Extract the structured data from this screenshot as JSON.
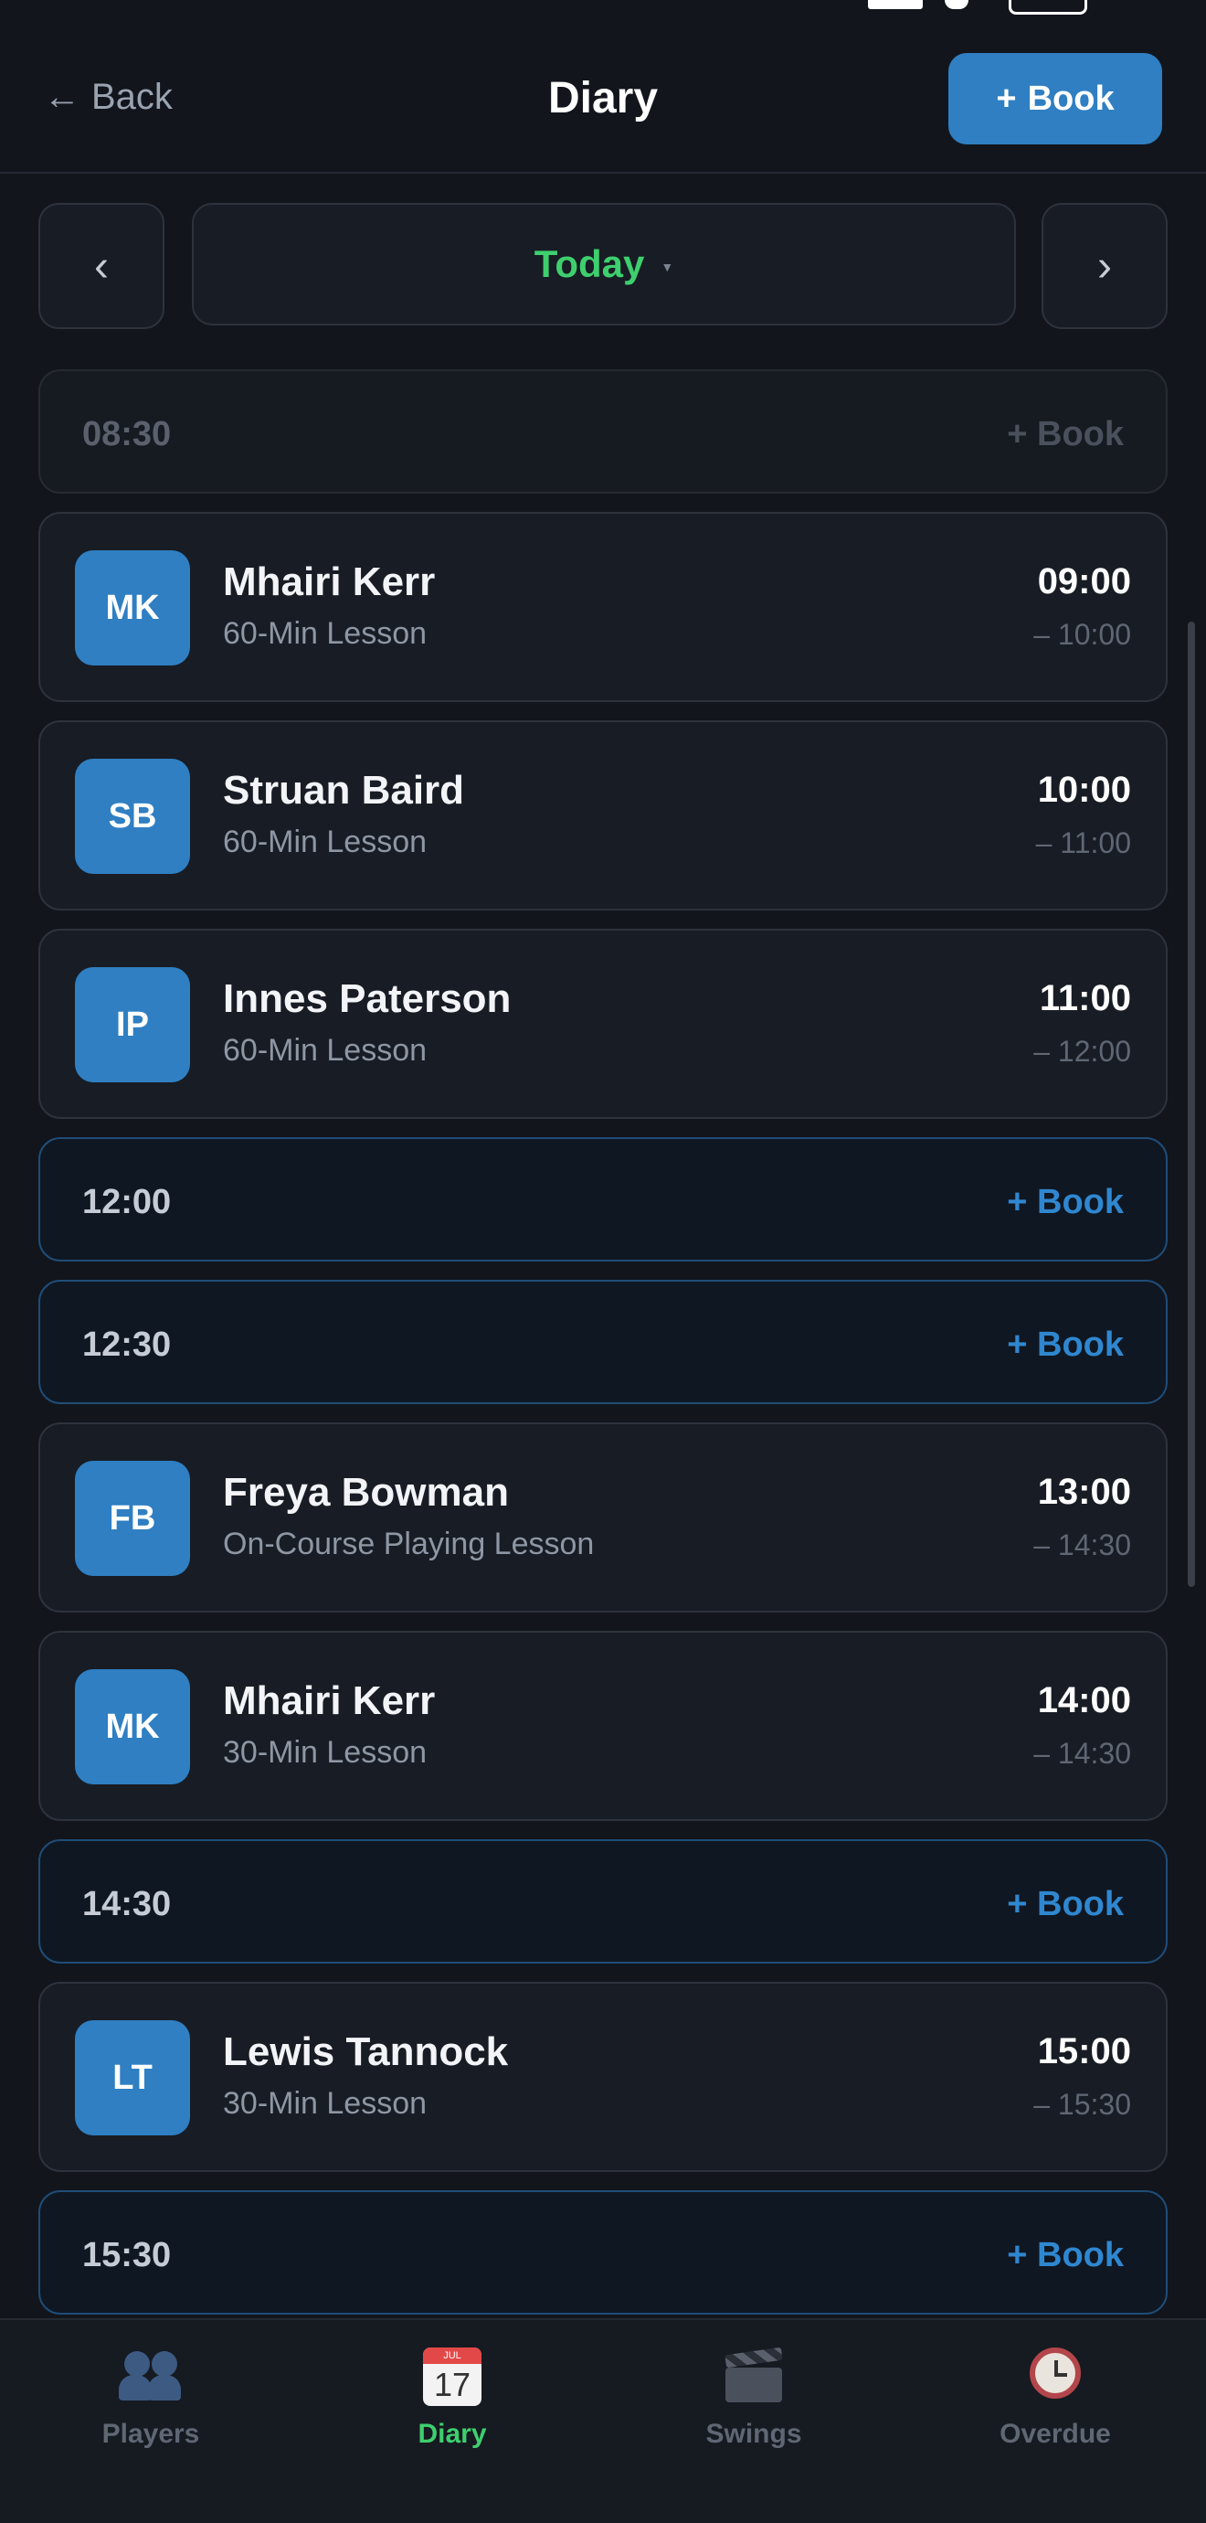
{
  "header": {
    "back_label": "Back",
    "title": "Diary",
    "book_label": "Book"
  },
  "date_nav": {
    "label": "Today",
    "accent": "#3ecf6e"
  },
  "slots": [
    {
      "kind": "free",
      "state": "past",
      "time": "08:30",
      "action": "+ Book"
    },
    {
      "kind": "booked",
      "initials": "MK",
      "name": "Mhairi Kerr",
      "lesson": "60-Min Lesson",
      "start": "09:00",
      "end": "– 10:00"
    },
    {
      "kind": "booked",
      "initials": "SB",
      "name": "Struan Baird",
      "lesson": "60-Min Lesson",
      "start": "10:00",
      "end": "– 11:00"
    },
    {
      "kind": "booked",
      "initials": "IP",
      "name": "Innes Paterson",
      "lesson": "60-Min Lesson",
      "start": "11:00",
      "end": "– 12:00"
    },
    {
      "kind": "free",
      "state": "open",
      "time": "12:00",
      "action": "+ Book"
    },
    {
      "kind": "free",
      "state": "open",
      "time": "12:30",
      "action": "+ Book"
    },
    {
      "kind": "booked",
      "initials": "FB",
      "name": "Freya Bowman",
      "lesson": "On-Course Playing Lesson",
      "start": "13:00",
      "end": "– 14:30"
    },
    {
      "kind": "booked",
      "initials": "MK",
      "name": "Mhairi Kerr",
      "lesson": "30-Min Lesson",
      "start": "14:00",
      "end": "– 14:30"
    },
    {
      "kind": "free",
      "state": "open",
      "time": "14:30",
      "action": "+ Book"
    },
    {
      "kind": "booked",
      "initials": "LT",
      "name": "Lewis Tannock",
      "lesson": "30-Min Lesson",
      "start": "15:00",
      "end": "– 15:30"
    },
    {
      "kind": "free",
      "state": "open",
      "time": "15:30",
      "action": "+ Book"
    }
  ],
  "tabs": [
    {
      "label": "Players",
      "icon": "players-icon",
      "active": false
    },
    {
      "label": "Diary",
      "icon": "calendar-icon",
      "active": true
    },
    {
      "label": "Swings",
      "icon": "clapperboard-icon",
      "active": false
    },
    {
      "label": "Overdue",
      "icon": "alarm-clock-icon",
      "active": false
    }
  ],
  "colors": {
    "background": "#12151c",
    "primary": "#2f7fc2",
    "active_tab": "#3ecf6e"
  }
}
